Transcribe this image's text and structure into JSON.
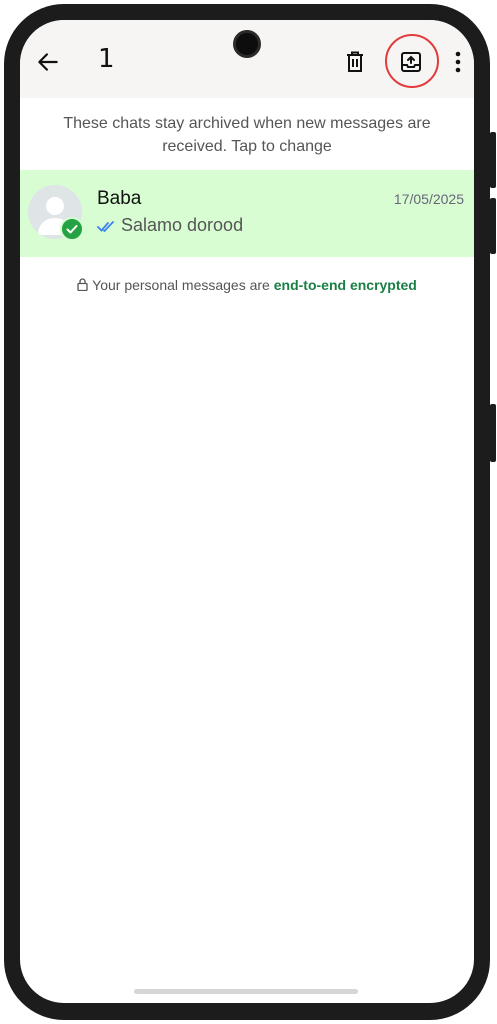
{
  "topbar": {
    "selected_count": "1",
    "back_icon": "arrow-left-icon",
    "delete_icon": "trash-icon",
    "unarchive_icon": "unarchive-icon",
    "more_icon": "more-vertical-icon"
  },
  "info_text": "These chats stay archived when new messages are received. Tap to change",
  "chats": [
    {
      "name": "Baba",
      "date": "17/05/2025",
      "message": "Salamo dorood",
      "read_status": "double-tick-blue",
      "selected": true
    }
  ],
  "encryption": {
    "prefix": "Your personal messages are",
    "link": "end-to-end encrypted"
  },
  "colors": {
    "selected_row": "#d9fdd3",
    "accent_green": "#1a7f44",
    "badge_green": "#25a244",
    "highlight_ring": "#e23b3b",
    "tick_blue": "#3b82f6"
  }
}
